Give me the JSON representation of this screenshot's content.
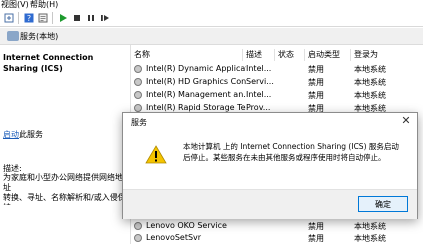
{
  "menu": {
    "view_label": "视图(V)",
    "help_label": "帮助(H)"
  },
  "scope": {
    "title": "服务(本地)"
  },
  "left_pane": {
    "service_title": "Internet Connection Sharing (ICS)",
    "start_link_text": "启动",
    "start_link_suffix": "此服务",
    "description_label": "描述:",
    "description_text": "为家庭和小型办公网络提供网络地址\n转换、寻址、名称解析和/或入侵保护\n服务。"
  },
  "list": {
    "headers": {
      "name": "名称",
      "description": "描述",
      "status": "状态",
      "startup": "启动类型",
      "logon": "登录为"
    },
    "rows": [
      {
        "name": "Intel(R) Dynamic Applicat...",
        "description": "Intel...",
        "status": "",
        "startup": "禁用",
        "logon": "本地系统"
      },
      {
        "name": "Intel(R) HD Graphics Con...",
        "description": "Servi...",
        "status": "",
        "startup": "禁用",
        "logon": "本地系统"
      },
      {
        "name": "Intel(R) Management an...",
        "description": "Intel...",
        "status": "",
        "startup": "禁用",
        "logon": "本地系统"
      },
      {
        "name": "Intel(R) Rapid Storage Te...",
        "description": "Prov...",
        "status": "",
        "startup": "禁用",
        "logon": "本地系统"
      },
      {
        "name": "Lenovo OKO Service",
        "description": "",
        "status": "",
        "startup": "禁用",
        "logon": "本地系统"
      },
      {
        "name": "LenovoSetSvr",
        "description": "",
        "status": "",
        "startup": "禁用",
        "logon": "本地系统"
      }
    ]
  },
  "dialog": {
    "title": "服务",
    "message": "本地计算机 上的 Internet Connection Sharing (ICS) 服务启动后停止。某些服务在未由其他服务或程序使用时将自动停止。",
    "ok_label": "确定"
  },
  "colors": {
    "link": "#1a5bb8",
    "ok_border": "#0078d7",
    "warning": "#f5c400"
  }
}
